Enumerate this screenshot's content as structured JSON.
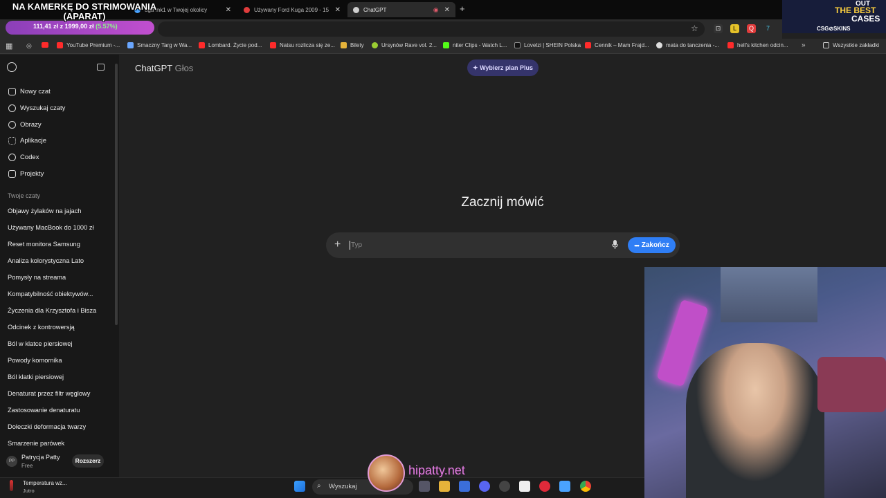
{
  "stream_overlay": {
    "title": "NA KAMERKĘ DO STRIMOWANIA (APARAT)",
    "goal_current": "111,41 zł",
    "goal_sep": "z",
    "goal_total": "1999,00 zł",
    "goal_percent": "(5.57%)",
    "streamer_site": "hipatty.net"
  },
  "promo": {
    "line1": "OUT",
    "line2": "THE BEST",
    "line3": "CASES",
    "brand": "CSG⊘SKINS"
  },
  "tabs": [
    {
      "label": "uga mk1 w Twojej okolicy",
      "color": "#4aa3ff"
    },
    {
      "label": "Używany Ford Kuga 2009 - 15",
      "color": "#e03c3c"
    },
    {
      "label": "ChatGPT",
      "color": "#cfcfcf",
      "active": true
    }
  ],
  "bookmarks": [
    {
      "label": "YouTube Premium -...",
      "color": "#ff2b2b"
    },
    {
      "label": "Smaczny Targ w Wa...",
      "color": "#6aa7ff"
    },
    {
      "label": "Lombard. Życie pod...",
      "color": "#ff2b2b"
    },
    {
      "label": "Natsu rozlicza się ze...",
      "color": "#ff2b2b"
    },
    {
      "label": "Bilety",
      "color": "#e6b33a"
    },
    {
      "label": "Ursynów Rave vol. 2...",
      "color": "#9acd32"
    },
    {
      "label": "niter Clips - Watch L...",
      "color": "#53fc18"
    },
    {
      "label": "Lovelzi | SHEIN Polska",
      "color": "#111111"
    },
    {
      "label": "Cennik – Mam Frajd...",
      "color": "#ff2b2b"
    },
    {
      "label": "mata do tanczenia -...",
      "color": "#dddddd"
    },
    {
      "label": "hell's kitchen odcin...",
      "color": "#ff2b2b"
    }
  ],
  "all_bookmarks": "Wszystkie zakładki",
  "sidebar": {
    "nav": [
      {
        "label": "Nowy czat",
        "icon": "edit-icon"
      },
      {
        "label": "Wyszukaj czaty",
        "icon": "search-icon"
      },
      {
        "label": "Obrazy",
        "icon": "image-icon"
      },
      {
        "label": "Aplikacje",
        "icon": "apps-icon"
      },
      {
        "label": "Codex",
        "icon": "codex-icon"
      },
      {
        "label": "Projekty",
        "icon": "folder-icon"
      }
    ],
    "chats_label": "Twoje czaty",
    "chats": [
      "Objawy żylaków na jajach",
      "Używany MacBook do 1000 zł",
      "Reset monitora Samsung",
      "Analiza kolorystyczna Lato",
      "Pomysły na streama",
      "Kompatybilność obiektywów...",
      "Życzenia dla Krzysztofa i Bisza",
      "Odcinek z kontrowersją",
      "Ból w klatce piersiowej",
      "Powody komornika",
      "Ból klatki piersiowej",
      "Denaturat przez filtr węglowy",
      "Zastosowanie denaturatu",
      "Dołeczki deformacja twarzy",
      "Smarzenie parówek"
    ],
    "user": {
      "initials": "PP",
      "name": "Patrycja Patty",
      "plan": "Free",
      "upgrade": "Rozszerz"
    }
  },
  "main": {
    "title": "ChatGPT",
    "title_suffix": "Głos",
    "plan_button": "Wybierz plan Plus",
    "headline": "Zacznij mówić",
    "input_placeholder": "Typ",
    "end_button": "Zakończ"
  },
  "taskbar": {
    "weather_title": "Temperatura wz...",
    "weather_sub": "Jutro",
    "search": "Wyszukaj"
  }
}
